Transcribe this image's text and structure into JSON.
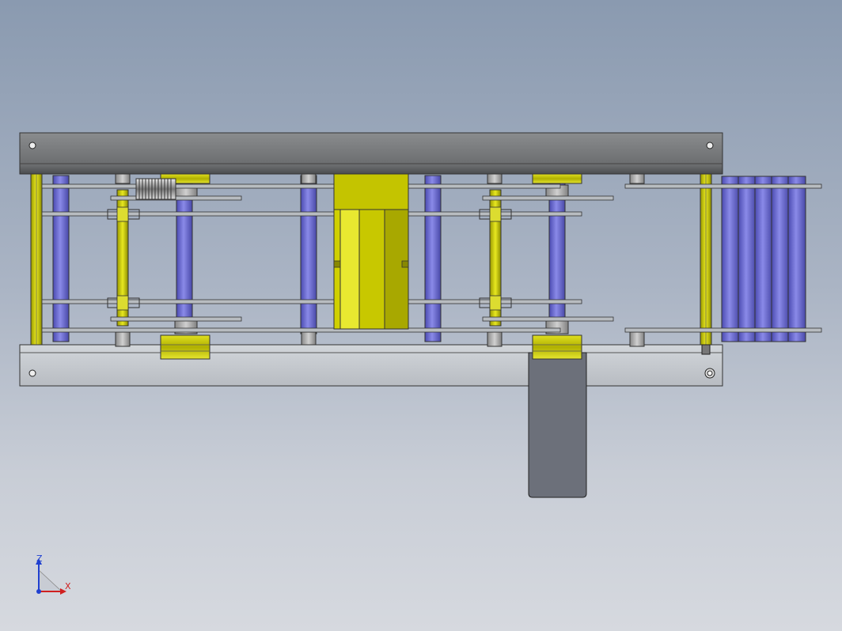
{
  "view": {
    "colors": {
      "background_top": "#8a9ab0",
      "background_bottom": "#d6d9df",
      "frame_gray": "#6e7072",
      "frame_light": "#c8ccd0",
      "yellow_part": "#c8c800",
      "blue_roller": "#6a6ad0",
      "shaft_gray": "#a8a8a8",
      "motor_plate": "#6c707a"
    }
  },
  "triad": {
    "z_label": "Z",
    "x_label": "X",
    "z_color": "#2040d0",
    "x_color": "#d02020"
  }
}
